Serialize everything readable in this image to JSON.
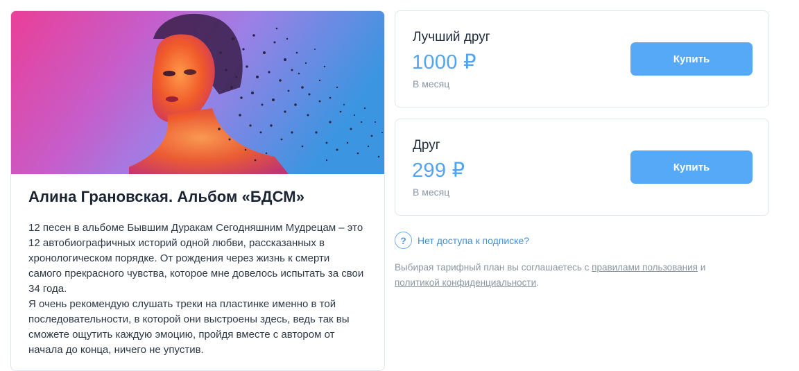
{
  "album": {
    "title": "Алина Грановская. Альбом «БДСМ»",
    "description": [
      "12 песен в альбоме Бывшим Дуракам Сегодняшним Мудрецам – это 12 автобиографичных историй одной любви, рассказанных в хронологическом порядке. От рождения через жизнь к смерти самого прекрасного чувства, которое мне довелось испытать за свои 34 года.",
      "Я очень рекомендую слушать треки на пластинке именно в той последовательности, в которой они выстроены здесь, ведь так вы сможете ощутить каждую эмоцию, пройдя вместе с автором от начала до конца, ничего не упустив."
    ]
  },
  "plans": [
    {
      "name": "Лучший друг",
      "price": "1000 ₽",
      "period": "В месяц",
      "button": "Купить"
    },
    {
      "name": "Друг",
      "price": "299 ₽",
      "period": "В месяц",
      "button": "Купить"
    }
  ],
  "no_access": {
    "icon": "help-icon",
    "label": "Нет доступа к подписке?",
    "icon_glyph": "?"
  },
  "terms": {
    "prefix": "Выбирая тарифный план вы соглашаетесь с ",
    "rules_link": "правилами пользования",
    "middle": " и ",
    "privacy_link": "политикой конфиденциальности",
    "suffix": "."
  },
  "colors": {
    "accent": "#55a9f7",
    "price": "#52a4f2",
    "link": "#3f8ee0",
    "muted": "#8b96a3",
    "border": "#dfe5ec"
  }
}
